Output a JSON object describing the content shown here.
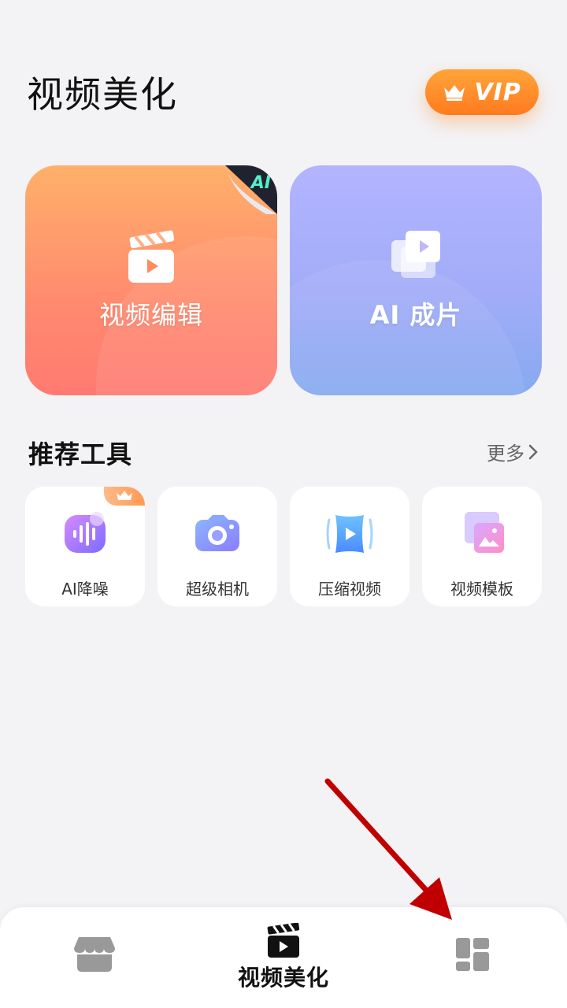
{
  "header": {
    "title": "视频美化",
    "vip_label": "VIP"
  },
  "cards": {
    "edit": {
      "label": "视频编辑",
      "badge": "AI"
    },
    "ai": {
      "label": "AI 成片"
    }
  },
  "tools_section": {
    "title": "推荐工具",
    "more_label": "更多"
  },
  "tools": [
    {
      "label": "AI降噪",
      "icon": "audio-wave-icon",
      "vip": true
    },
    {
      "label": "超级相机",
      "icon": "camera-icon",
      "vip": false
    },
    {
      "label": "压缩视频",
      "icon": "compress-video-icon",
      "vip": false
    },
    {
      "label": "视频模板",
      "icon": "video-template-icon",
      "vip": false
    }
  ],
  "bottom_nav": {
    "items": [
      {
        "icon": "shop-icon",
        "label": ""
      },
      {
        "icon": "clapperboard-icon",
        "label": "视频美化",
        "active": true
      },
      {
        "icon": "grid-icon",
        "label": ""
      }
    ]
  },
  "colors": {
    "vip": "#ff8a2a",
    "edit_card": "#ff9a6e",
    "ai_card": "#a6aef8",
    "annotation_arrow": "#c00000"
  }
}
